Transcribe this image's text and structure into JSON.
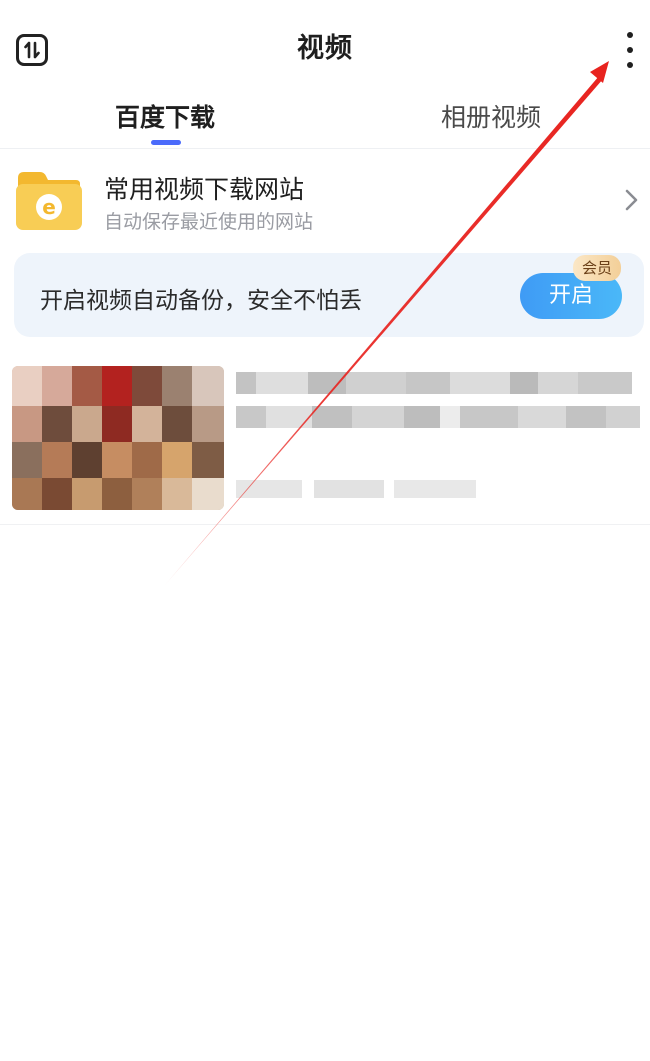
{
  "header": {
    "title": "视频",
    "sort_icon": "sort-arrows-icon",
    "more_icon": "more-vertical-icon"
  },
  "tabs": [
    {
      "label": "百度下载",
      "active": true
    },
    {
      "label": "相册视频",
      "active": false
    }
  ],
  "site_entry": {
    "title": "常用视频下载网站",
    "subtitle": "自动保存最近使用的网站",
    "folder_icon": "folder-browser-icon",
    "folder_letter": "e"
  },
  "backup_banner": {
    "text": "开启视频自动备份，安全不怕丢",
    "button_label": "开启",
    "badge": "会员"
  },
  "colors": {
    "accent": "#4b6bfb",
    "button_blue": "#3f9bf5",
    "folder_yellow": "#f6c549",
    "annotation_red": "#e8231f"
  }
}
